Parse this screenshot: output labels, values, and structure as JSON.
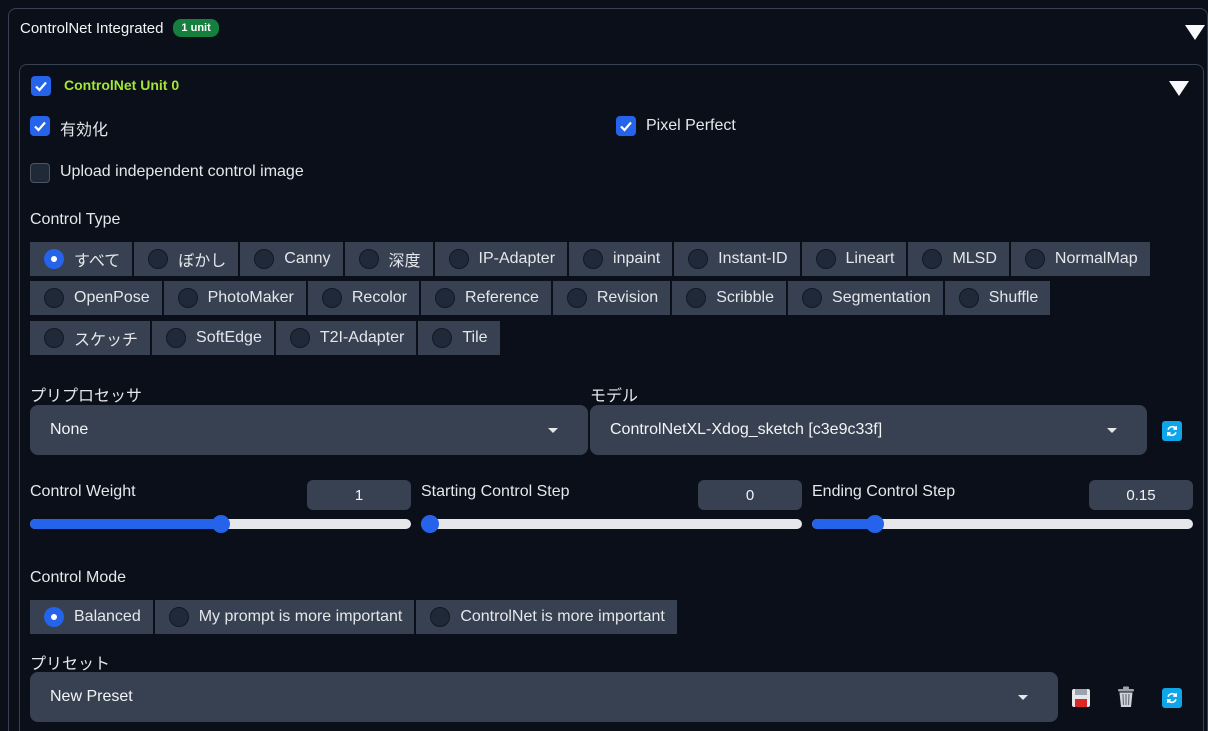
{
  "header": {
    "title": "ControlNet Integrated",
    "badge": "1 unit"
  },
  "unit": {
    "title": "ControlNet Unit 0",
    "enable_label": "有効化",
    "pixel_perfect_label": "Pixel Perfect",
    "upload_label": "Upload independent control image"
  },
  "control_type": {
    "label": "Control Type",
    "row1": [
      "すべて",
      "ぼかし",
      "Canny",
      "深度",
      "IP-Adapter",
      "inpaint",
      "Instant-ID",
      "Lineart",
      "MLSD",
      "NormalMap"
    ],
    "row2": [
      "OpenPose",
      "PhotoMaker",
      "Recolor",
      "Reference",
      "Revision",
      "Scribble",
      "Segmentation",
      "Shuffle"
    ],
    "row3": [
      "スケッチ",
      "SoftEdge",
      "T2I-Adapter",
      "Tile"
    ],
    "selected": "すべて"
  },
  "preprocessor": {
    "label": "プリプロセッサ",
    "value": "None"
  },
  "model": {
    "label": "モデル",
    "value": "ControlNetXL-Xdog_sketch [c3e9c33f]"
  },
  "sliders": {
    "weight": {
      "label": "Control Weight",
      "value": "1",
      "fraction": 0.5
    },
    "start": {
      "label": "Starting Control Step",
      "value": "0",
      "fraction": 0.0
    },
    "end": {
      "label": "Ending Control Step",
      "value": "0.15",
      "fraction": 0.15
    }
  },
  "control_mode": {
    "label": "Control Mode",
    "options": [
      "Balanced",
      "My prompt is more important",
      "ControlNet is more important"
    ],
    "selected": "Balanced"
  },
  "preset": {
    "label": "プリセット",
    "value": "New Preset"
  },
  "icons": {
    "refresh": "refresh-icon",
    "save": "save-icon",
    "delete": "trash-icon"
  },
  "colors": {
    "accent": "#2563eb",
    "badge": "#15803d",
    "unit_title": "#a3e635"
  }
}
